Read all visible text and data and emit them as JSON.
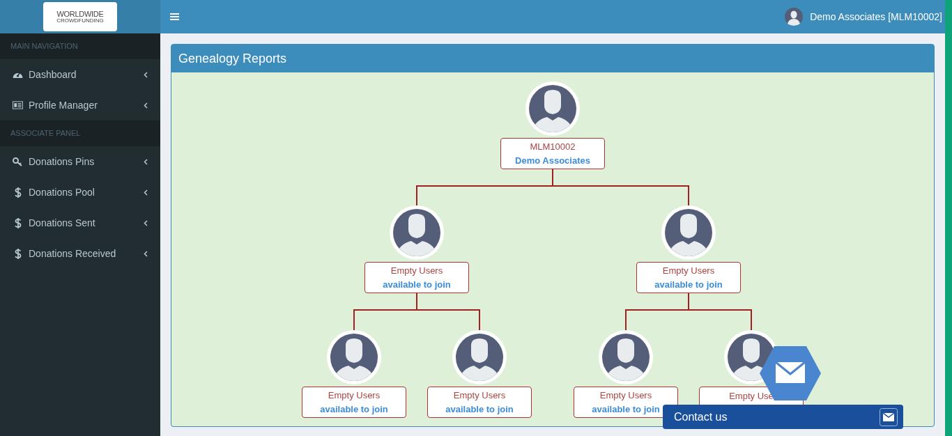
{
  "logo": {
    "line1": "WORLDWIDE",
    "line2": "CROWDFUNDING"
  },
  "user": {
    "name": "Demo Associates [MLM10002]"
  },
  "sidebar": {
    "sections": [
      {
        "header": "MAIN NAVIGATION",
        "items": [
          {
            "label": "Dashboard",
            "kind": "dashboard"
          },
          {
            "label": "Profile Manager",
            "kind": "profile"
          }
        ]
      },
      {
        "header": "ASSOCIATE PANEL",
        "items": [
          {
            "label": "Donations Pins",
            "kind": "pins"
          },
          {
            "label": "Donations Pool",
            "kind": "money"
          },
          {
            "label": "Donations Sent",
            "kind": "money"
          },
          {
            "label": "Donations Received",
            "kind": "money"
          }
        ]
      }
    ]
  },
  "panel": {
    "title": "Genealogy Reports",
    "tree": {
      "line1": "MLM10002",
      "line2": "Demo Associates",
      "children": [
        {
          "line1": "Empty Users",
          "line2": "available to join",
          "children": [
            {
              "line1": "Empty Users",
              "line2": "available to join"
            },
            {
              "line1": "Empty Users",
              "line2": "available to join"
            }
          ]
        },
        {
          "line1": "Empty Users",
          "line2": "available to join",
          "children": [
            {
              "line1": "Empty Users",
              "line2": "available to join"
            },
            {
              "line1": "Empty Use"
            }
          ]
        }
      ]
    }
  },
  "contact": {
    "label": "Contact us"
  }
}
